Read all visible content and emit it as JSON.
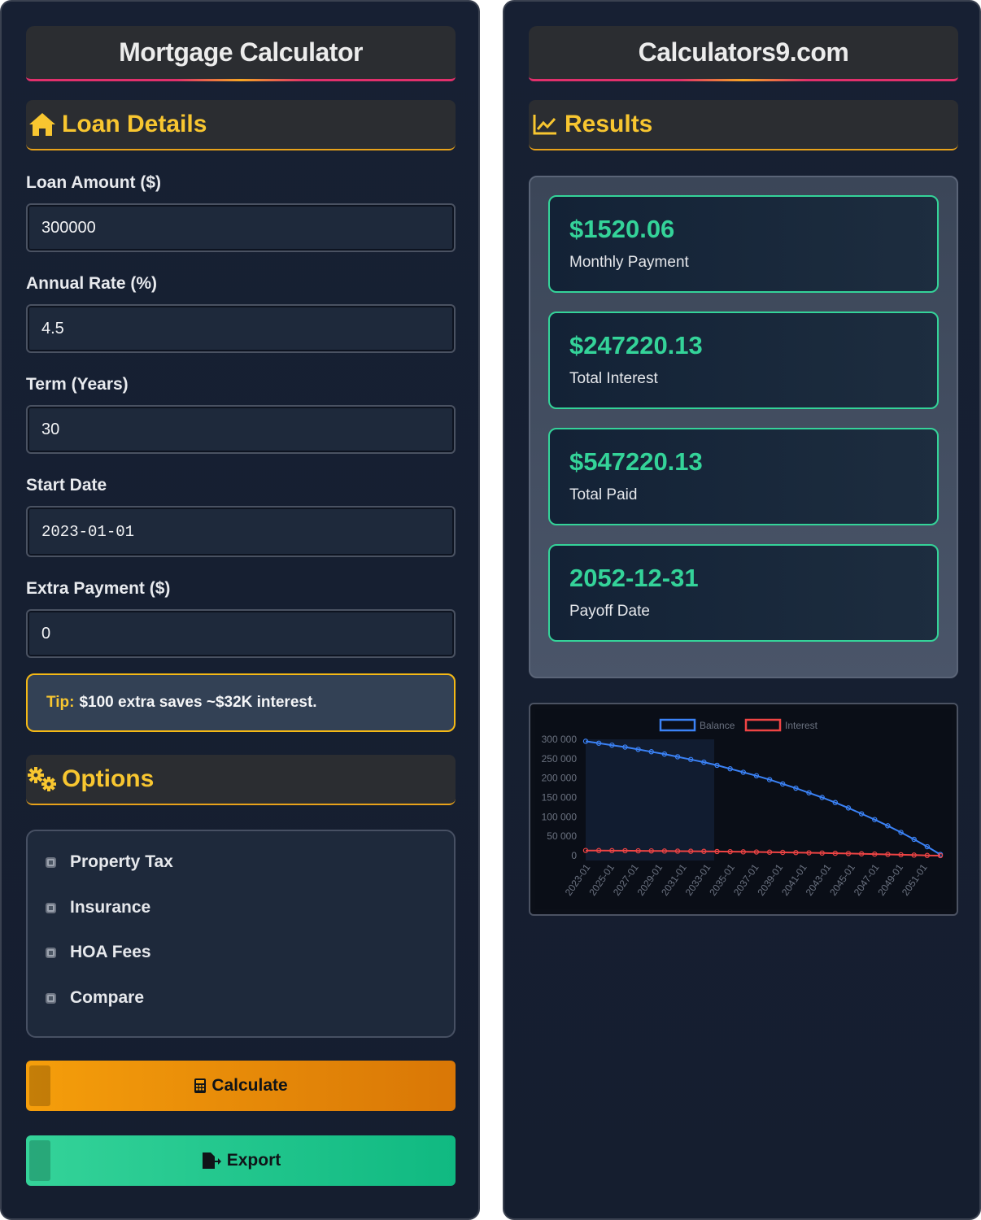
{
  "left": {
    "title": "Mortgage Calculator",
    "loan_section": "Loan Details",
    "fields": [
      {
        "label": "Loan Amount ($)",
        "value": "300000"
      },
      {
        "label": "Annual Rate (%)",
        "value": "4.5"
      },
      {
        "label": "Term (Years)",
        "value": "30"
      },
      {
        "label": "Start Date",
        "value": "2023-01-01"
      },
      {
        "label": "Extra Payment ($)",
        "value": "0"
      }
    ],
    "tip_label": "Tip:",
    "tip_text": "$100 extra saves ~$32K interest.",
    "options_section": "Options",
    "options": [
      "Property Tax",
      "Insurance",
      "HOA Fees",
      "Compare"
    ],
    "calculate_label": "Calculate",
    "export_label": "Export"
  },
  "right": {
    "title": "Calculators9.com",
    "results_section": "Results",
    "results": [
      {
        "value": "$1520.06",
        "label": "Monthly Payment"
      },
      {
        "value": "$247220.13",
        "label": "Total Interest"
      },
      {
        "value": "$547220.13",
        "label": "Total Paid"
      },
      {
        "value": "2052-12-31",
        "label": "Payoff Date"
      }
    ]
  },
  "colors": {
    "accent_gold": "#f8c630",
    "accent_green": "#34d399",
    "balance_line": "#3b82f6",
    "interest_line": "#ef4444"
  },
  "chart_data": {
    "type": "line",
    "legend": [
      "Balance",
      "Interest"
    ],
    "legend_position": "top",
    "ylim": [
      0,
      300000
    ],
    "y_ticks": [
      "300 000",
      "250 000",
      "200 000",
      "150 000",
      "100 000",
      "50 000",
      "0"
    ],
    "x_ticks": [
      "2023-01",
      "2025-01",
      "2027-01",
      "2029-01",
      "2031-01",
      "2033-01",
      "2035-01",
      "2037-01",
      "2039-01",
      "2041-01",
      "2043-01",
      "2045-01",
      "2047-01",
      "2049-01",
      "2051-01"
    ],
    "series": [
      {
        "name": "Balance",
        "color": "#3b82f6",
        "values": [
          295000,
          290000,
          285000,
          280000,
          274000,
          268000,
          262000,
          255000,
          248000,
          241000,
          233000,
          224000,
          215000,
          206000,
          196000,
          185000,
          174000,
          162000,
          150000,
          137000,
          123000,
          108000,
          93000,
          77000,
          60000,
          42000,
          23000,
          3000
        ]
      },
      {
        "name": "Interest",
        "color": "#ef4444",
        "values": [
          13300,
          13100,
          12900,
          12700,
          12400,
          12200,
          11900,
          11600,
          11300,
          11000,
          10600,
          10200,
          9800,
          9400,
          8900,
          8400,
          7900,
          7300,
          6700,
          6100,
          5400,
          4700,
          4000,
          3200,
          2300,
          1400,
          500,
          100
        ]
      }
    ]
  }
}
